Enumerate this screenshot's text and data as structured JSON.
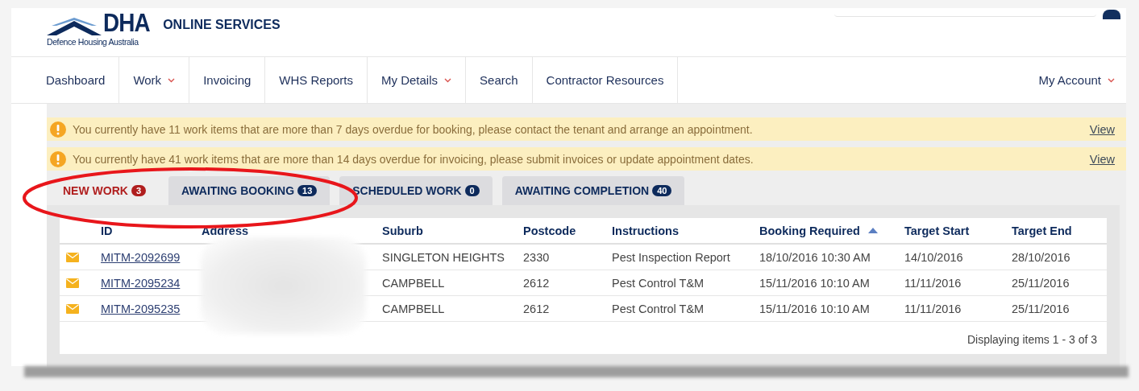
{
  "header": {
    "logo_text": "DHA",
    "logo_subtitle": "Defence Housing Australia",
    "site_title": "ONLINE SERVICES"
  },
  "nav": {
    "items": [
      {
        "label": "Dashboard",
        "dropdown": false
      },
      {
        "label": "Work",
        "dropdown": true
      },
      {
        "label": "Invoicing",
        "dropdown": false
      },
      {
        "label": "WHS Reports",
        "dropdown": false
      },
      {
        "label": "My Details",
        "dropdown": true
      },
      {
        "label": "Search",
        "dropdown": false
      },
      {
        "label": "Contractor Resources",
        "dropdown": false
      }
    ],
    "account": {
      "label": "My Account",
      "dropdown": true
    }
  },
  "alerts": [
    {
      "text": "You currently have 11 work items that are more than 7 days overdue for booking, please contact the tenant and arrange an appointment.",
      "link": "View"
    },
    {
      "text": "You currently have 41 work items that are more than 14 days overdue for invoicing, please submit invoices or update appointment dates.",
      "link": "View"
    }
  ],
  "tabs": [
    {
      "label": "NEW WORK",
      "count": "3",
      "selected": true
    },
    {
      "label": "AWAITING BOOKING",
      "count": "13",
      "selected": false
    },
    {
      "label": "SCHEDULED WORK",
      "count": "0",
      "selected": false
    },
    {
      "label": "AWAITING COMPLETION",
      "count": "40",
      "selected": false
    }
  ],
  "table": {
    "columns": [
      {
        "label": "ID",
        "sorted": false
      },
      {
        "label": "Address",
        "sorted": false
      },
      {
        "label": "Suburb",
        "sorted": false
      },
      {
        "label": "Postcode",
        "sorted": false
      },
      {
        "label": "Instructions",
        "sorted": false
      },
      {
        "label": "Booking Required",
        "sorted": true
      },
      {
        "label": "Target Start",
        "sorted": false
      },
      {
        "label": "Target End",
        "sorted": false
      }
    ],
    "rows": [
      {
        "id": "MITM-2092699",
        "suburb": "SINGLETON HEIGHTS",
        "postcode": "2330",
        "instructions": "Pest Inspection Report",
        "booking_required": "18/10/2016 10:30 AM",
        "target_start": "14/10/2016",
        "target_end": "28/10/2016"
      },
      {
        "id": "MITM-2095234",
        "suburb": "CAMPBELL",
        "postcode": "2612",
        "instructions": "Pest Control T&M",
        "booking_required": "15/11/2016 10:10 AM",
        "target_start": "11/11/2016",
        "target_end": "25/11/2016"
      },
      {
        "id": "MITM-2095235",
        "suburb": "CAMPBELL",
        "postcode": "2612",
        "instructions": "Pest Control T&M",
        "booking_required": "15/11/2016 10:10 AM",
        "target_start": "11/11/2016",
        "target_end": "25/11/2016"
      }
    ],
    "footer": "Displaying items 1 - 3 of 3"
  }
}
